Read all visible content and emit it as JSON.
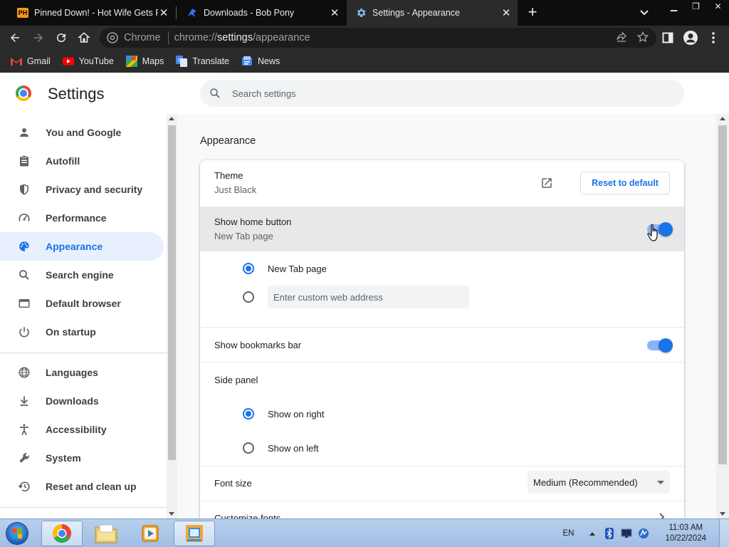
{
  "tabs": [
    {
      "title": "Pinned Down! - Hot Wife Gets Po",
      "favicon": "ph-favicon",
      "active": false
    },
    {
      "title": "Downloads - Bob Pony",
      "favicon": "bob-pony-favicon",
      "active": false
    },
    {
      "title": "Settings - Appearance",
      "favicon": "settings-gear-favicon",
      "active": true
    }
  ],
  "omnibox": {
    "site_label": "Chrome",
    "url_scheme": "chrome://",
    "url_host": "settings",
    "url_path": "/appearance"
  },
  "bookmarks": [
    {
      "label": "Gmail",
      "icon": "gmail-icon"
    },
    {
      "label": "YouTube",
      "icon": "youtube-icon"
    },
    {
      "label": "Maps",
      "icon": "maps-icon"
    },
    {
      "label": "Translate",
      "icon": "translate-icon"
    },
    {
      "label": "News",
      "icon": "news-icon"
    }
  ],
  "settings": {
    "title": "Settings",
    "search_placeholder": "Search settings"
  },
  "sidebar": {
    "items": [
      {
        "label": "You and Google",
        "icon": "person-icon"
      },
      {
        "label": "Autofill",
        "icon": "clipboard-icon"
      },
      {
        "label": "Privacy and security",
        "icon": "shield-icon"
      },
      {
        "label": "Performance",
        "icon": "speedometer-icon"
      },
      {
        "label": "Appearance",
        "icon": "palette-icon",
        "active": true
      },
      {
        "label": "Search engine",
        "icon": "search-icon"
      },
      {
        "label": "Default browser",
        "icon": "browser-icon"
      },
      {
        "label": "On startup",
        "icon": "power-icon"
      },
      {
        "label": "Languages",
        "icon": "globe-icon"
      },
      {
        "label": "Downloads",
        "icon": "download-icon"
      },
      {
        "label": "Accessibility",
        "icon": "accessibility-icon"
      },
      {
        "label": "System",
        "icon": "wrench-icon"
      },
      {
        "label": "Reset and clean up",
        "icon": "restore-icon"
      }
    ]
  },
  "appearance": {
    "section_title": "Appearance",
    "theme_label": "Theme",
    "theme_value": "Just Black",
    "reset_label": "Reset to default",
    "home_button_label": "Show home button",
    "home_button_sub": "New Tab page",
    "home_button_enabled": true,
    "home_option_newtab": "New Tab page",
    "home_custom_placeholder": "Enter custom web address",
    "bookmarks_bar_label": "Show bookmarks bar",
    "bookmarks_bar_enabled": true,
    "side_panel_label": "Side panel",
    "side_panel_right": "Show on right",
    "side_panel_left": "Show on left",
    "font_size_label": "Font size",
    "font_size_value": "Medium (Recommended)",
    "customize_fonts_label": "Customize fonts"
  },
  "taskbar": {
    "language": "EN",
    "time": "11:03 AM",
    "date": "10/22/2024"
  },
  "colors": {
    "accent": "#1a73e8",
    "active_sidebar_bg": "#e8f0fe",
    "tabstrip_bg": "#0d0d0d",
    "toolbar_bg": "#2b2b2b"
  }
}
